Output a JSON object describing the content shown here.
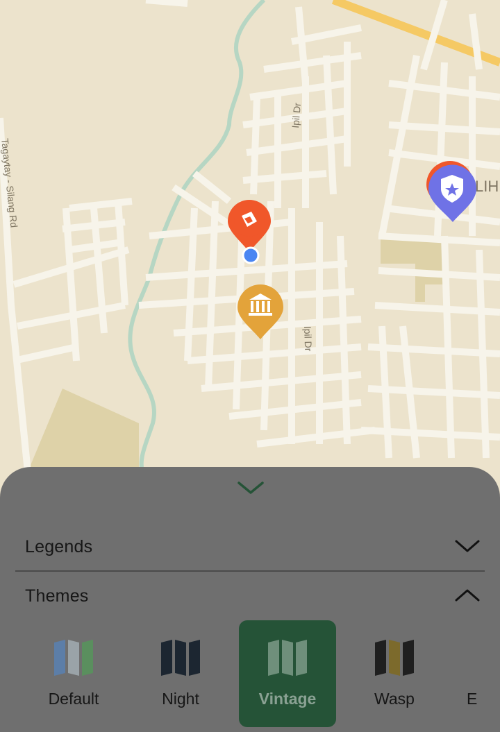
{
  "map": {
    "street_labels": [
      "Ipil Dr",
      "Ipil Dr",
      "Tagaytay - Silang Rd",
      "LIH"
    ],
    "markers": [
      {
        "name": "orange-category-marker-icon",
        "color": "#f0572a"
      },
      {
        "name": "museum-marker-icon",
        "color": "#e3a33a"
      },
      {
        "name": "police-shield-marker-icon",
        "color": "#6f72e6"
      },
      {
        "name": "current-location-dot",
        "color": "#4a86f2"
      }
    ]
  },
  "sheet": {
    "grab_icon": "chevron-down-icon",
    "sections": [
      {
        "label": "Legends",
        "expanded": false
      },
      {
        "label": "Themes",
        "expanded": true
      }
    ],
    "themes": [
      {
        "label": "Default",
        "selected": false,
        "colors": [
          "#5c7ea8",
          "#9aa3a8",
          "#5a8f5e"
        ]
      },
      {
        "label": "Night",
        "selected": false,
        "colors": [
          "#1c2631",
          "#1c2631",
          "#1c2631"
        ]
      },
      {
        "label": "Vintage",
        "selected": true,
        "colors": [
          "#6f8f7b",
          "#6f8f7b",
          "#6f8f7b"
        ]
      },
      {
        "label": "Wasp",
        "selected": false,
        "colors": [
          "#1f1f1f",
          "#7c6a2c",
          "#1f1f1f"
        ]
      },
      {
        "label": "E",
        "selected": false
      }
    ]
  },
  "colors": {
    "map_bg": "#ece3cc",
    "road": "#f7f4ea",
    "highway": "#f5c964",
    "water": "#b6d6c3",
    "park": "#ded2a8",
    "sheet": "#6f6f6f",
    "selected": "#255337"
  }
}
